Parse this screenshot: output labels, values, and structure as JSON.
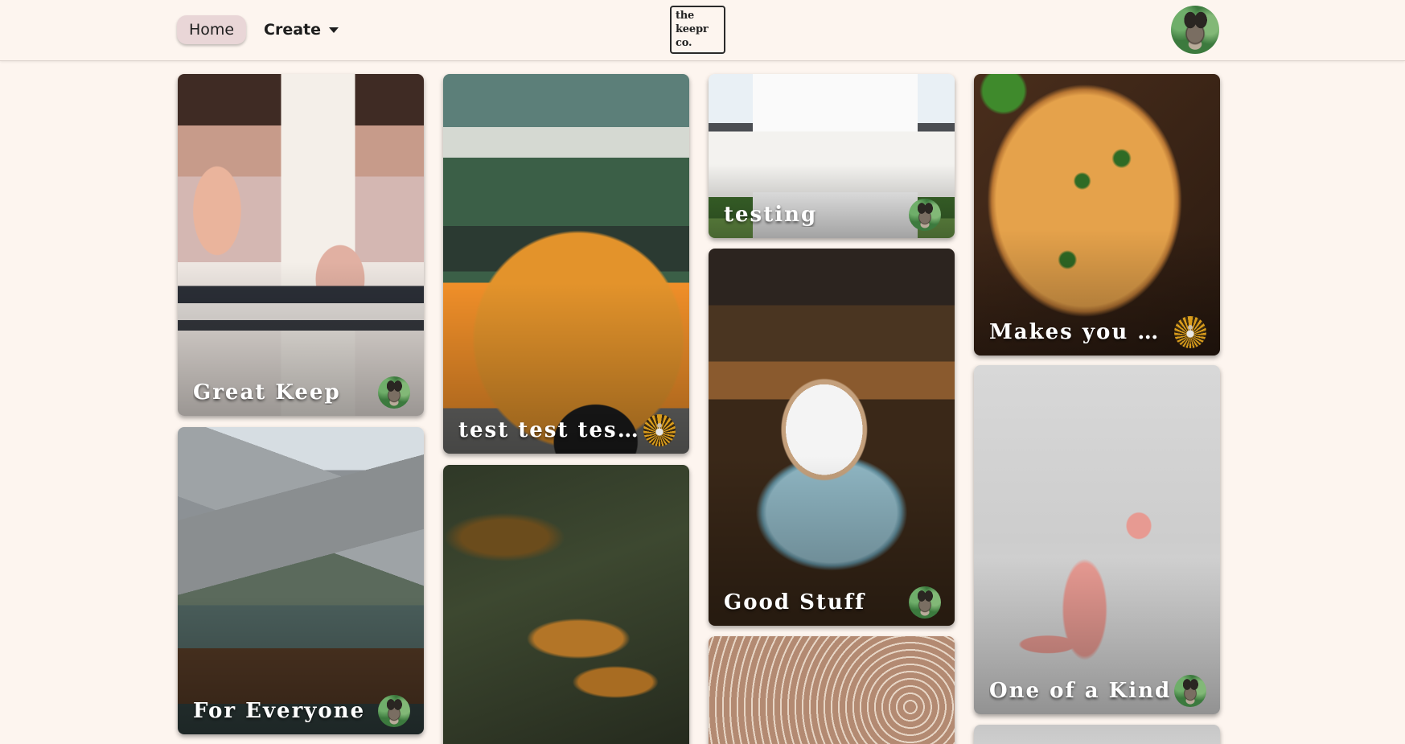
{
  "nav": {
    "home_label": "Home",
    "create_label": "Create",
    "logo": {
      "line1": "the",
      "line2": "keepr",
      "line3": "co."
    }
  },
  "cards": [
    {
      "title": "Great Keep",
      "image": "mug-desk-photo",
      "avatar": "llama-avatar"
    },
    {
      "title": "For Everyone",
      "image": "mountain-lake-photo",
      "avatar": "llama-avatar"
    },
    {
      "title": "test test test t...",
      "image": "orange-beetle-car-photo",
      "avatar": "peacock-avatar"
    },
    {
      "title": "",
      "image": "blurred-flowers-photo",
      "avatar": ""
    },
    {
      "title": "testing",
      "image": "white-house-photo",
      "avatar": "llama-avatar"
    },
    {
      "title": "Good Stuff",
      "image": "espresso-cup-photo",
      "avatar": "llama-avatar"
    },
    {
      "title": "",
      "image": "makeup-palette-photo",
      "avatar": ""
    },
    {
      "title": "Makes you Wo...",
      "image": "pizza-photo",
      "avatar": "peacock-avatar"
    },
    {
      "title": "One of a Kind",
      "image": "pink-dinosaur-photo",
      "avatar": "llama-avatar"
    },
    {
      "title": "",
      "image": "gray-photo",
      "avatar": ""
    }
  ],
  "colors": {
    "background": "#fdf5ef",
    "home_button": "#e9d6d7",
    "card_title": "#ffffff"
  }
}
